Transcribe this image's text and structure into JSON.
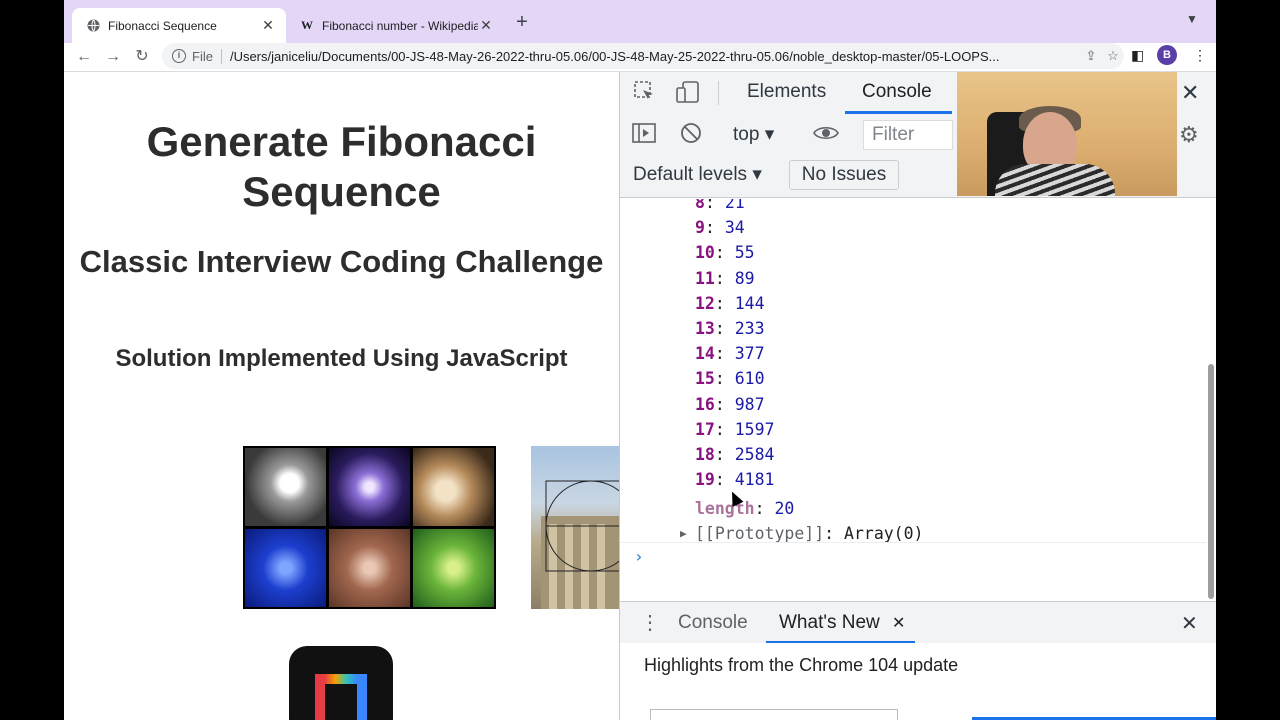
{
  "tabs": [
    {
      "title": "Fibonacci Sequence",
      "favicon": "globe-icon",
      "active": true
    },
    {
      "title": "Fibonacci number - Wikipedia",
      "favicon": "W",
      "active": false
    }
  ],
  "toolbar": {
    "security_label": "File",
    "url": "/Users/janiceliu/Documents/00-JS-48-May-26-2022-thru-05.06/00-JS-48-May-25-2022-thru-05.06/noble_desktop-master/05-LOOPS...",
    "avatar_letter": "B"
  },
  "page": {
    "title": "Generate Fibonacci Sequence",
    "subtitle": "Classic Interview Coding Challenge",
    "tagline": "Solution Implemented Using JavaScript"
  },
  "devtools": {
    "tabs": [
      "Elements",
      "Console"
    ],
    "context": "top ▾",
    "filter_placeholder": "Filter",
    "levels": "Default levels ▾",
    "issues": "No Issues",
    "console_rows": [
      {
        "k": "8",
        "v": "21"
      },
      {
        "k": "9",
        "v": "34"
      },
      {
        "k": "10",
        "v": "55"
      },
      {
        "k": "11",
        "v": "89"
      },
      {
        "k": "12",
        "v": "144"
      },
      {
        "k": "13",
        "v": "233"
      },
      {
        "k": "14",
        "v": "377"
      },
      {
        "k": "15",
        "v": "610"
      },
      {
        "k": "16",
        "v": "987"
      },
      {
        "k": "17",
        "v": "1597"
      },
      {
        "k": "18",
        "v": "2584"
      },
      {
        "k": "19",
        "v": "4181"
      }
    ],
    "length_key": "length",
    "length_value": "20",
    "prototype_key": "[[Prototype]]",
    "prototype_value": "Array(0)",
    "prompt": "›",
    "drawer_tabs": [
      "Console",
      "What's New"
    ],
    "drawer_heading": "Highlights from the Chrome 104 update"
  },
  "colors": {
    "tabstrip": "#e4d6f6",
    "accent": "#1a73e8",
    "key": "#881280",
    "number": "#1a1aa6"
  }
}
